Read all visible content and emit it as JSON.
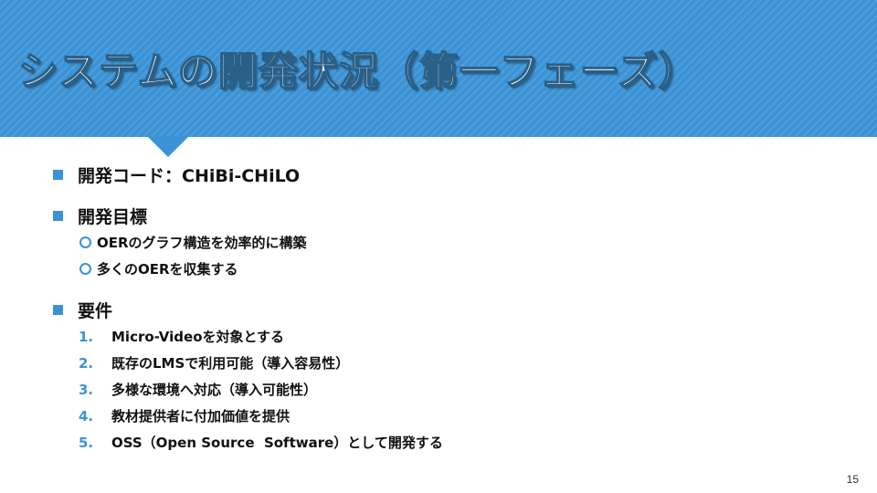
{
  "slide": {
    "title": "システムの開発状況（第一フェーズ）",
    "page_number": "15",
    "accent_color": "#3b93d6"
  },
  "sections": [
    {
      "heading": "開発コード：CHiBi-CHiLO"
    },
    {
      "heading": "開発目標",
      "items": [
        "OERのグラフ構造を効率的に構築",
        "多くのOERを収集する"
      ]
    },
    {
      "heading": "要件",
      "numbered": [
        {
          "num": "1.",
          "text": "Micro-Videoを対象とする"
        },
        {
          "num": "2.",
          "text": "既存のLMSで利用可能（導入容易性）"
        },
        {
          "num": "3.",
          "text": "多様な環境へ対応（導入可能性）"
        },
        {
          "num": "4.",
          "text": "教材提供者に付加価値を提供"
        },
        {
          "num": "5.",
          "text": "OSS（Open Source  Software）として開発する"
        }
      ]
    }
  ]
}
